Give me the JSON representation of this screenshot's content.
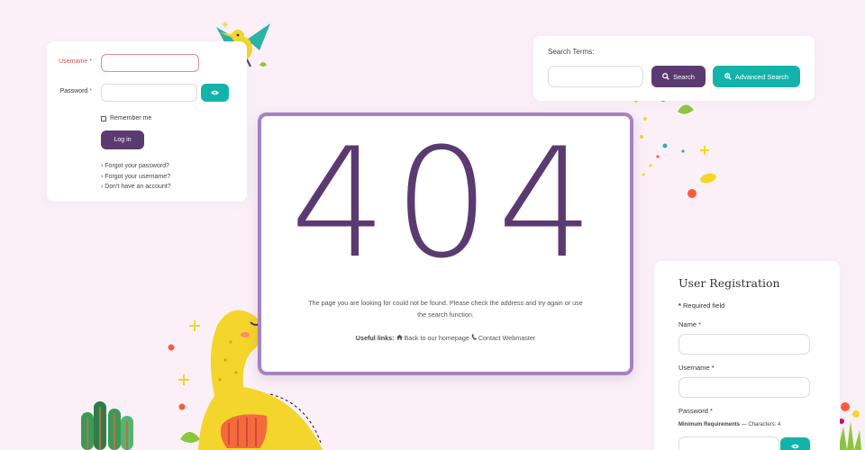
{
  "login": {
    "username_label": "Username",
    "password_label": "Password",
    "required_mark": "*",
    "remember_label": "Remember me",
    "login_button": "Log in",
    "links": [
      "› Forgot your password?",
      "› Forgot your username?",
      "› Don't have an account?"
    ]
  },
  "search": {
    "label": "Search Terms:",
    "search_button": "Search",
    "advanced_button": "Advanced Search"
  },
  "error": {
    "code": "404",
    "message": "The page you are looking for could not be found. Please check the address and try again or use the search function.",
    "useful_label": "Useful links:",
    "home_link": "Back to our homepage",
    "contact_link": "Contact Webmaster"
  },
  "registration": {
    "title": "User Registration",
    "required_note": "Required field",
    "required_star": "*",
    "name_label": "Name",
    "username_label": "Username",
    "password_label": "Password",
    "min_req_label": "Minimum Requirements",
    "min_req_value": "— Characters: 4"
  },
  "colors": {
    "primary": "#5b3a72",
    "accent": "#14b3aa",
    "frame": "#a781c0",
    "background": "#fbf0f8"
  },
  "icons": [
    "eye-icon",
    "search-icon",
    "zoom-in-icon",
    "home-icon",
    "phone-icon"
  ]
}
